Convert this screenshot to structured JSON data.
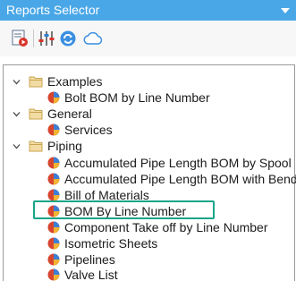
{
  "window": {
    "title": "Reports Selector"
  },
  "toolbar": {
    "buttons": [
      {
        "name": "run-report-icon"
      },
      {
        "name": "report-settings-icon"
      },
      {
        "name": "refresh-icon"
      },
      {
        "name": "cloud-icon"
      }
    ]
  },
  "tree": {
    "groups": [
      {
        "label": "Examples",
        "items": [
          "Bolt BOM by Line Number"
        ]
      },
      {
        "label": "General",
        "items": [
          "Services"
        ]
      },
      {
        "label": "Piping",
        "items": [
          "Accumulated Pipe Length BOM by Spool",
          "Accumulated Pipe Length BOM with Bends",
          "Bill of Materials",
          "BOM By Line Number",
          "Component Take off by Line Number",
          "Isometric Sheets",
          "Pipelines",
          "Valve List"
        ]
      }
    ],
    "highlighted_item": "BOM By Line Number"
  },
  "colors": {
    "title_bar": "#49a7e7",
    "highlight_border": "#1aa587",
    "folder": "#e8c77f"
  }
}
